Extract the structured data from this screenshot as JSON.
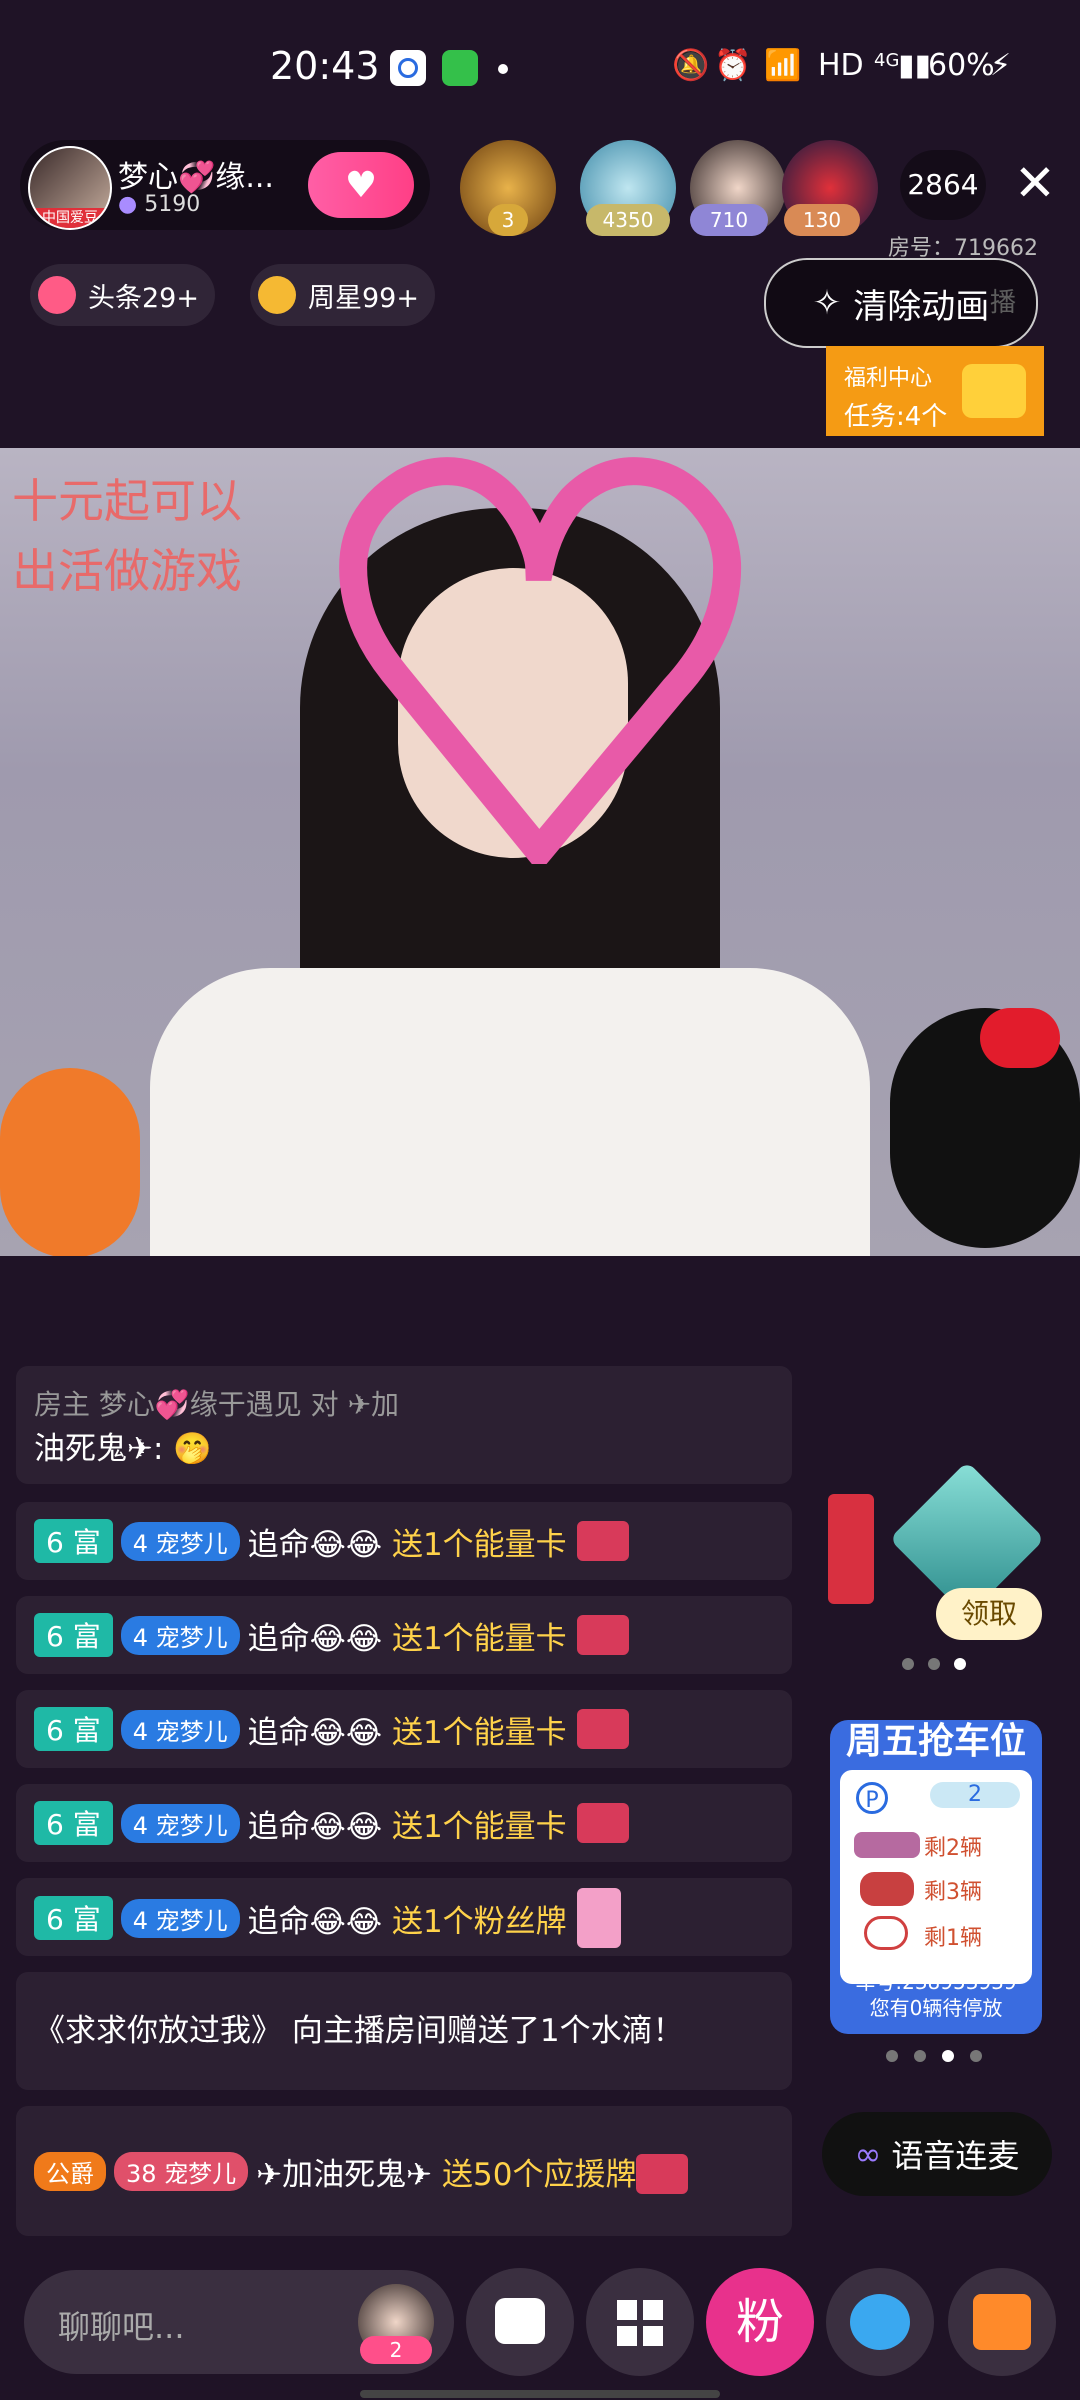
{
  "status_bar": {
    "time": "20:43",
    "network": "HD",
    "signal": "4G",
    "battery": "60%"
  },
  "host": {
    "name": "梦心💞缘...",
    "fans": "5190",
    "avatar_tag": "中国爱豆"
  },
  "top_viewers": [
    {
      "badge": "3",
      "color": "#d7a83a"
    },
    {
      "badge": "4350",
      "color": "#d3c46a"
    },
    {
      "badge": "710",
      "color": "#8f86d6"
    },
    {
      "badge": "130",
      "color": "#d98a55"
    }
  ],
  "viewer_count": "2864",
  "room_no": "房号：719662",
  "chips": {
    "headline": "头条29+",
    "weekly_star": "周星99+"
  },
  "clear_animation": "清除动画",
  "partial_label": "播",
  "welfare": {
    "title": "福利中心",
    "tasks": "任务:4个"
  },
  "video_overlay": {
    "line1": "十元起可以",
    "line2": "出活做游戏"
  },
  "chat": {
    "partial_top": "房主    梦心💞缘于遇见 对 ✈加",
    "partial_top_line2": "油死鬼✈: 🤭",
    "rows": [
      {
        "level": "6 富",
        "pet_level": "4",
        "pet": "宠梦儿",
        "user": "追命😂😂",
        "action": "送1个能量卡"
      },
      {
        "level": "6 富",
        "pet_level": "4",
        "pet": "宠梦儿",
        "user": "追命😂😂",
        "action": "送1个能量卡"
      },
      {
        "level": "6 富",
        "pet_level": "4",
        "pet": "宠梦儿",
        "user": "追命😂😂",
        "action": "送1个能量卡"
      },
      {
        "level": "6 富",
        "pet_level": "4",
        "pet": "宠梦儿",
        "user": "追命😂😂",
        "action": "送1个能量卡"
      },
      {
        "level": "6 富",
        "pet_level": "4",
        "pet": "宠梦儿",
        "user": "追命😂😂",
        "action": "送1个粉丝牌"
      }
    ],
    "system_msg": "《求求你放过我》 向主播房间赠送了1个水滴！",
    "last": {
      "title": "公爵",
      "pet_level": "38",
      "pet": "宠梦儿",
      "user": "✈加油死鬼✈",
      "action": "送50个应援牌"
    }
  },
  "claim": {
    "label": "领取"
  },
  "parking": {
    "title": "周五抢车位",
    "spot": "2",
    "items": [
      "剩2辆",
      "剩3辆",
      "剩1辆"
    ],
    "plate": "车号:238953939",
    "pending": "您有0辆待停放"
  },
  "voice_link": "语音连麦",
  "bottom": {
    "placeholder": "聊聊吧...",
    "viewer_badge": "2",
    "fans_label": "粉"
  }
}
